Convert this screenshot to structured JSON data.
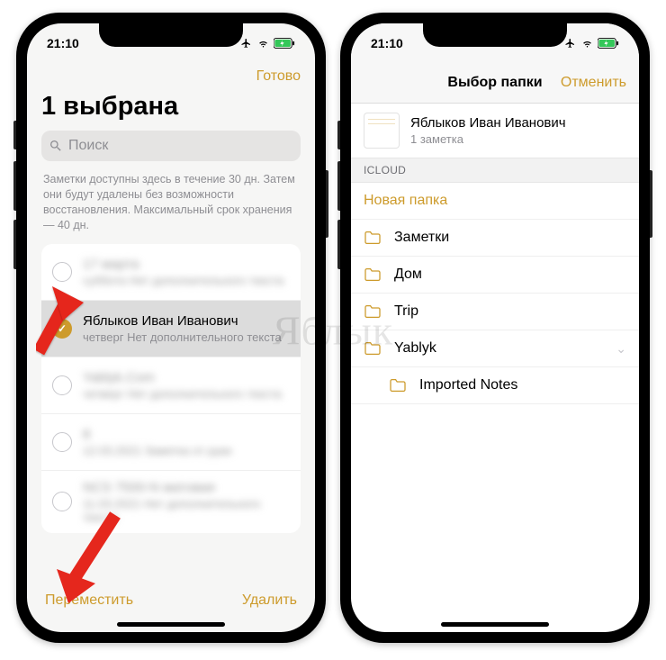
{
  "watermark": "Яблык",
  "statusbar": {
    "time": "21:10"
  },
  "left": {
    "done": "Готово",
    "title": "1 выбрана",
    "search": {
      "placeholder": "Поиск"
    },
    "info": "Заметки доступны здесь в течение 30 дн. Затем они будут удалены без возможности восстановления. Максимальный срок хранения — 40 дн.",
    "rows": [
      {
        "title": "17 марта",
        "sub": "суббота  Нет дополнительного текста",
        "blur": true
      },
      {
        "title": "Яблыков Иван Иванович",
        "sub": "четверг  Нет дополнительного текста",
        "selected": true
      },
      {
        "title": "Yablyk.Com",
        "sub": "четверг  Нет дополнительного текста",
        "blur": true
      },
      {
        "title": "8",
        "sub": "12.03.2021  Заметка от руки",
        "blur": true
      },
      {
        "title": "NCS 7500-N матовая",
        "sub": "11.03.2021  Нет дополнительного текста",
        "blur": true
      }
    ],
    "move": "Переместить",
    "delete": "Удалить"
  },
  "right": {
    "nav_title": "Выбор папки",
    "cancel": "Отменить",
    "note": {
      "title": "Яблыков Иван Иванович",
      "sub": "1 заметка"
    },
    "section": "ICLOUD",
    "new_folder": "Новая папка",
    "folders": [
      {
        "name": "Заметки",
        "indent": false
      },
      {
        "name": "Дом",
        "indent": false
      },
      {
        "name": "Trip",
        "indent": false
      },
      {
        "name": "Yablyk",
        "indent": false,
        "expandable": true
      },
      {
        "name": "Imported Notes",
        "indent": true
      }
    ]
  },
  "colors": {
    "accent": "#cd9b2c"
  }
}
